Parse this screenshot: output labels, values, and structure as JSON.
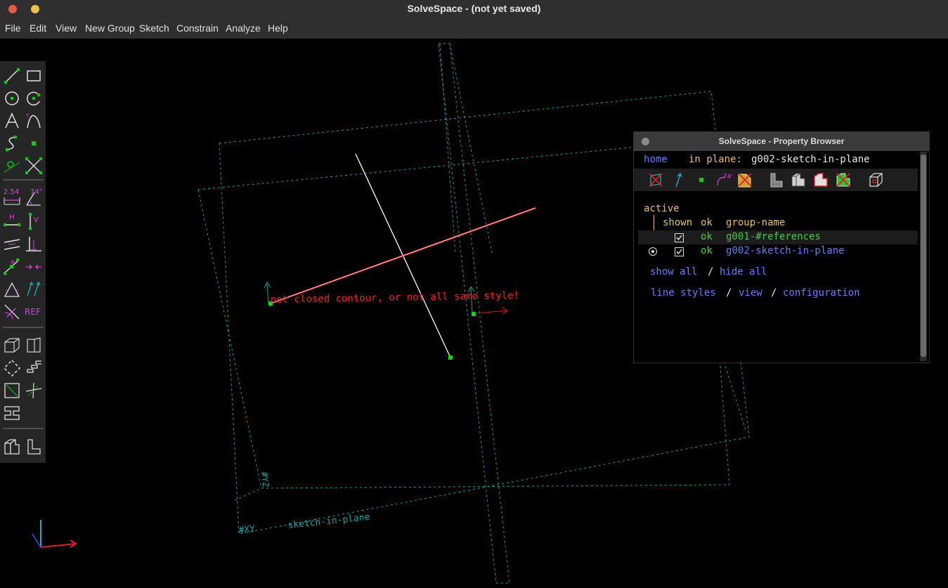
{
  "window": {
    "title": "SolveSpace - (not yet saved)"
  },
  "menu": {
    "items": [
      "File",
      "Edit",
      "View",
      "New Group",
      "Sketch",
      "Constrain",
      "Analyze",
      "Help"
    ]
  },
  "canvas": {
    "error_message": "not closed contour, or not all same style!",
    "workplane_label": "sketch-in-plane",
    "plane_tag_xy": "#XY",
    "plane_tag_yz": "#YZ"
  },
  "toolbar": {
    "dimension_label": "2.54",
    "angle_label": "74°",
    "horizontal_label": "H",
    "vertical_label": "V",
    "reference_label": "REF",
    "icons": [
      "line-icon",
      "rectangle-icon",
      "circle-icon",
      "arc-icon",
      "text-icon",
      "tangent-arc-icon",
      "bezier-icon",
      "point-icon",
      "point-on-entity-icon",
      "split-curves-icon",
      "distance-dimension-icon",
      "angle-dimension-icon",
      "horizontal-icon",
      "vertical-icon",
      "parallel-icon",
      "perpendicular-icon",
      "point-on-line-icon",
      "symmetric-icon",
      "equal-icon",
      "same-orientation-icon",
      "other-supplementary-icon",
      "reference-icon",
      "extrude-icon",
      "lathe-icon",
      "step-rotate-icon",
      "step-translate-icon",
      "workplane-icon",
      "new-workplane-icon",
      "assemble-icon",
      "sketch-in-3d-icon",
      "sketch-in-plane-icon"
    ]
  },
  "property_browser": {
    "title": "SolveSpace - Property Browser",
    "home": "home",
    "in_plane_label": "in plane:",
    "in_plane_value": "g002-sketch-in-plane",
    "active_header": "active",
    "col_shown": "shown",
    "col_ok": "ok",
    "col_group_name": "group-name",
    "groups": [
      {
        "ok": "ok",
        "name": "g001-#references",
        "shown": true,
        "active": false
      },
      {
        "ok": "ok",
        "name": "g002-sketch-in-plane",
        "shown": true,
        "active": true
      }
    ],
    "show_all": "show all",
    "separator": "/",
    "hide_all": "hide all",
    "line_styles": "line styles",
    "view": "view",
    "configuration": "configuration",
    "icons": [
      "workplanes-toggle-icon",
      "normals-toggle-icon",
      "points-toggle-icon",
      "constraints-toggle-icon",
      "faces-toggle-icon",
      "shaded-icon",
      "edges-icon",
      "outlines-icon",
      "mesh-icon",
      "hidden-lines-icon"
    ]
  },
  "colors": {
    "background": "#000000",
    "workplane": "#1aa3a3",
    "error": "#ff2020",
    "point": "#00e000",
    "link": "#6a7cff",
    "header": "#e8c060",
    "ok": "#30e030",
    "green_text": "#48c848"
  }
}
